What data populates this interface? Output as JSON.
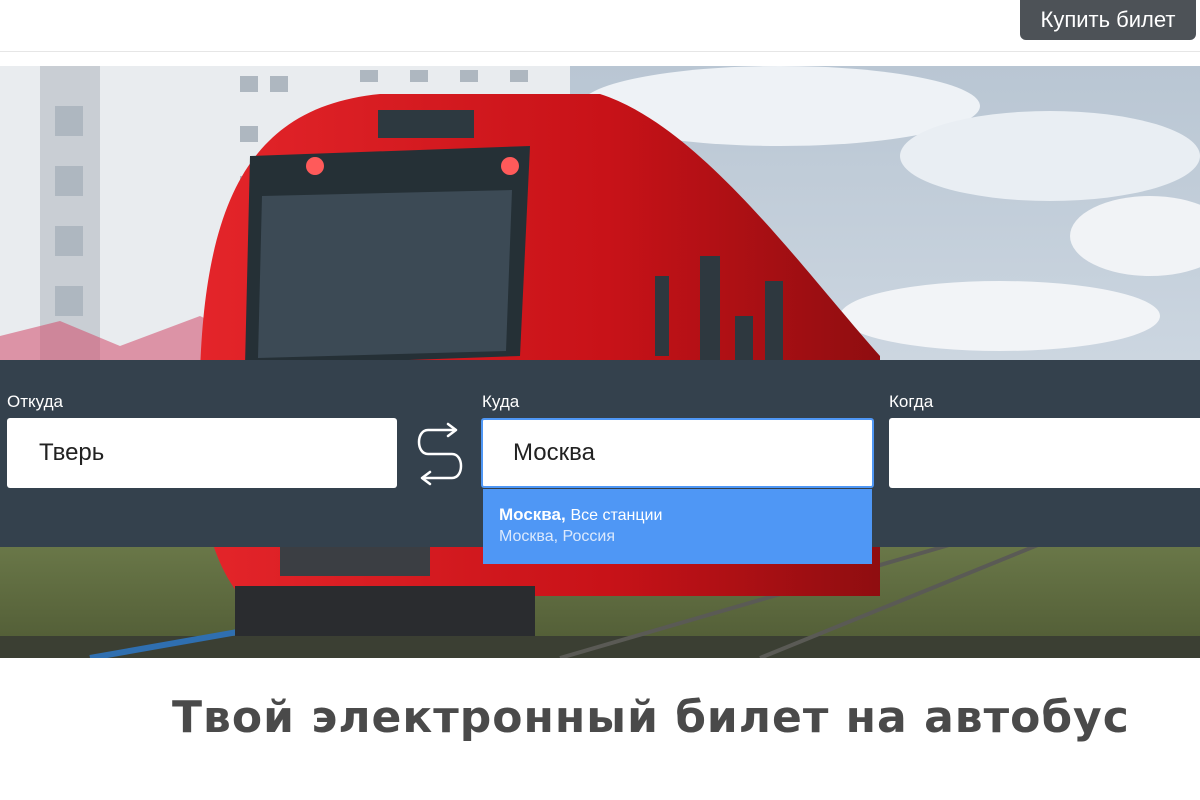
{
  "header": {
    "buy_button": "Купить билет"
  },
  "search": {
    "from": {
      "label": "Откуда",
      "value": "Тверь"
    },
    "to": {
      "label": "Куда",
      "value": "Москва"
    },
    "when": {
      "label": "Когда",
      "value": ""
    },
    "suggestion": {
      "city": "Москва",
      "separator": ",",
      "scope": "Все станции",
      "region": "Москва, Россия"
    }
  },
  "headline": "Твой электронный билет на автобус",
  "colors": {
    "band": "#34414d",
    "accent": "#4f97f5",
    "button": "#4d5257",
    "train": "#d0161a"
  },
  "icons": {
    "swap": "swap-arrows-icon"
  }
}
